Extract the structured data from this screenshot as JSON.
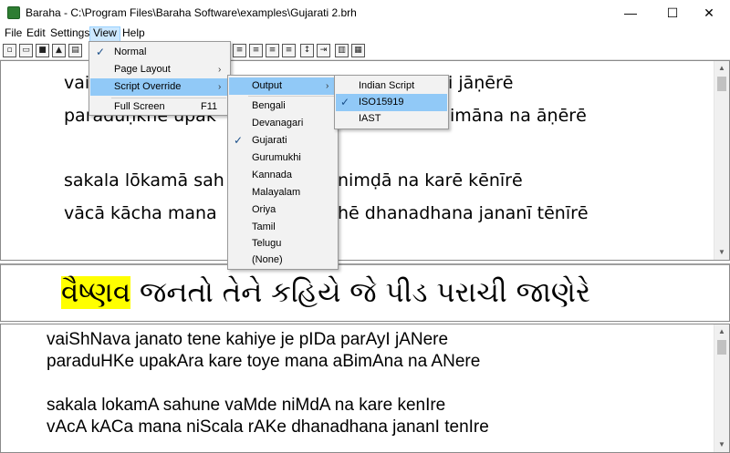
{
  "window": {
    "title": "Baraha - C:\\Program Files\\Baraha Software\\examples\\Gujarati 2.brh",
    "minimize_glyph": "—",
    "maximize_glyph": "☐",
    "close_glyph": "✕"
  },
  "menubar": {
    "items": [
      "File",
      "Edit",
      "Settings",
      "View",
      "Help"
    ],
    "active": "View"
  },
  "toolbar": {
    "icons": [
      "new-icon",
      "open-icon",
      "save-icon",
      "upload-icon",
      "print-icon",
      "align-left-icon",
      "align-center-icon",
      "align-right-icon",
      "justify-icon",
      "line-spacing-icon",
      "indent-icon",
      "single-pane-icon",
      "split-pane-icon"
    ]
  },
  "view_menu": {
    "items": [
      {
        "label": "Normal",
        "checked": true
      },
      {
        "label": "Page Layout",
        "submenu": true
      },
      {
        "label": "Script Override",
        "submenu": true,
        "highlighted": true
      },
      {
        "label": "Full Screen",
        "shortcut": "F11"
      }
    ]
  },
  "script_override_menu": {
    "items": [
      {
        "label": "Output",
        "submenu": true,
        "highlighted": true
      },
      {
        "label": "Bengali"
      },
      {
        "label": "Devanagari"
      },
      {
        "label": "Gujarati",
        "checked": true
      },
      {
        "label": "Gurumukhi"
      },
      {
        "label": "Kannada"
      },
      {
        "label": "Malayalam"
      },
      {
        "label": "Oriya"
      },
      {
        "label": "Tamil"
      },
      {
        "label": "Telugu"
      },
      {
        "label": "(None)"
      }
    ]
  },
  "output_menu": {
    "items": [
      {
        "label": "Indian Script"
      },
      {
        "label": "ISO15919",
        "checked": true,
        "highlighted": true
      },
      {
        "label": "IAST"
      }
    ]
  },
  "top_pane": {
    "lines": [
      {
        "left": "vai",
        "right": "i jāṇērē"
      },
      {
        "left": "paraduḥkhē upak",
        "right": "imāna na āṇērē"
      },
      {
        "left": "",
        "right": ""
      },
      {
        "left": "sakala lōkamā sah",
        "right": "nimḍā na karē kēnīrē"
      },
      {
        "left": "vācā kācha mana",
        "right": "hē dhanadhana jananī tēnīrē"
      }
    ]
  },
  "middle_pane": {
    "highlighted_word": "વૈષ્ણવ",
    "rest": " જનતો તેને કહિયે જે પીડ પરાચી જાણેરે",
    "highlight_color": "#ffff00"
  },
  "bottom_pane": {
    "lines": [
      "vaiShNava janato tene kahiye je pIDa parAyI jANere",
      "paraduHKe upakAra kare toye mana aBimAna na ANere",
      "",
      "sakala lokamA sahune vaMde niMdA na kare kenIre",
      "vAcA kACa mana niScala rAKe dhanadhana jananI tenIre"
    ]
  },
  "colors": {
    "menu_highlight": "#91c9f7",
    "menubar_active": "#cce8ff",
    "check": "#1a4f8a"
  }
}
